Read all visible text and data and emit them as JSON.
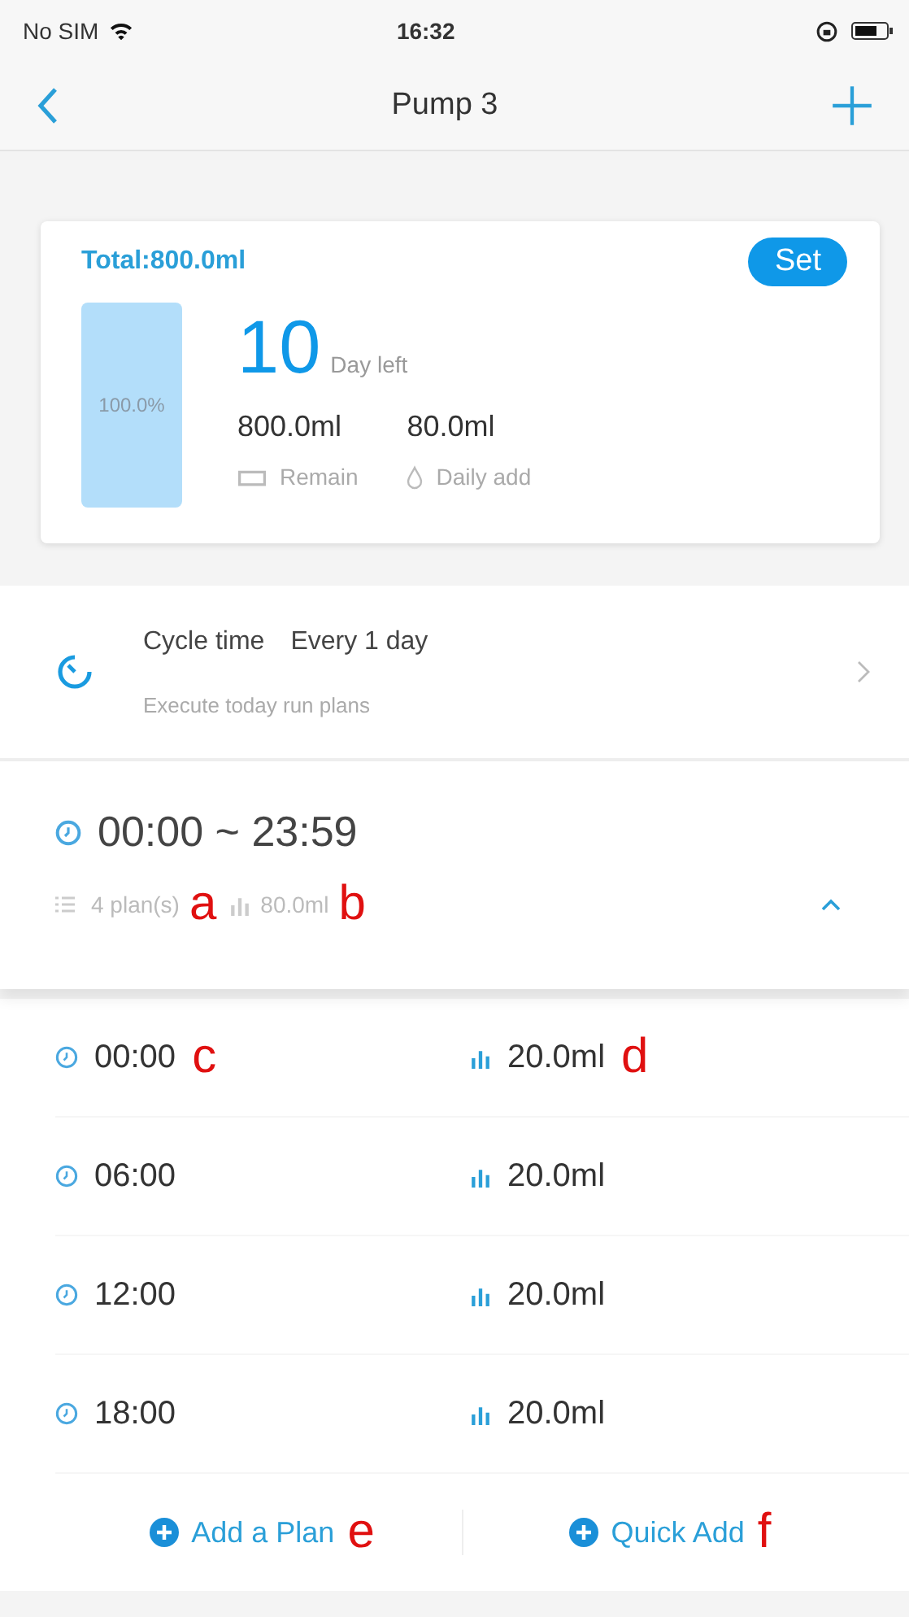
{
  "status_bar": {
    "carrier": "No SIM",
    "time": "16:32"
  },
  "nav": {
    "title": "Pump 3"
  },
  "summary": {
    "total": "Total:800.0ml",
    "set_button": "Set",
    "tank": {
      "percent": "100.0%"
    },
    "days": "10",
    "days_label": "Day left",
    "remain": "800.0ml",
    "remain_label": "Remain",
    "daily": "80.0ml",
    "daily_label": "Daily add"
  },
  "cycle": {
    "label": "Cycle time",
    "value": "Every 1 day",
    "subtitle": "Execute today run plans"
  },
  "range": {
    "title": "00:00 ~ 23:59",
    "plans": "4 plan(s)",
    "total": "80.0ml",
    "expanded": true,
    "annotations": [
      "a",
      "b"
    ]
  },
  "plans": [
    {
      "time": "00:00",
      "amount": "20.0ml",
      "time_note": "c",
      "amount_note": "d"
    },
    {
      "time": "06:00",
      "amount": "20.0ml"
    },
    {
      "time": "12:00",
      "amount": "20.0ml"
    },
    {
      "time": "18:00",
      "amount": "20.0ml"
    }
  ],
  "actions": [
    {
      "label": "Add a Plan",
      "note": "e"
    },
    {
      "label": "Quick Add",
      "note": "f"
    }
  ]
}
